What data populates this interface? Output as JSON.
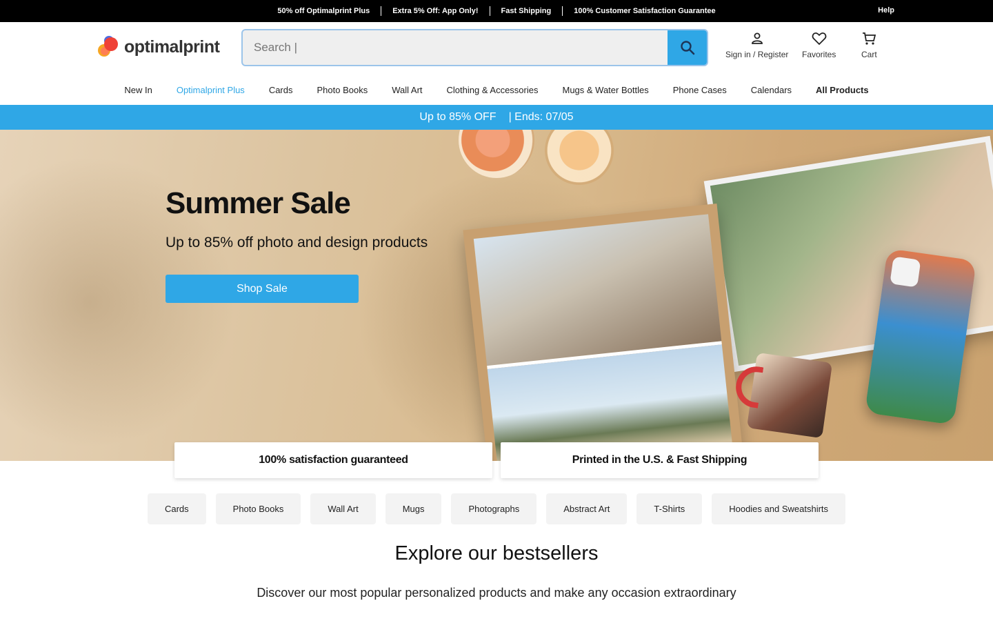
{
  "topbar": {
    "promos": [
      "50% off Optimalprint Plus",
      "Extra 5% Off: App Only!",
      "Fast Shipping",
      "100% Customer Satisfaction Guarantee"
    ],
    "help": "Help"
  },
  "header": {
    "logo_text": "optimalprint",
    "search_placeholder": "Search |",
    "actions": {
      "account": "Sign in / Register",
      "favorites": "Favorites",
      "cart": "Cart"
    }
  },
  "nav": {
    "items": [
      "New In",
      "Optimalprint Plus",
      "Cards",
      "Photo Books",
      "Wall Art",
      "Clothing & Accessories",
      "Mugs & Water Bottles",
      "Phone Cases",
      "Calendars",
      "All Products"
    ]
  },
  "sale_bar": {
    "offer": "Up to 85% OFF",
    "ends": "| Ends: 07/05"
  },
  "hero": {
    "title": "Summer Sale",
    "subtitle": "Up to 85% off photo and design products",
    "cta": "Shop Sale"
  },
  "features": [
    "100% satisfaction guaranteed",
    "Printed in the U.S. & Fast Shipping"
  ],
  "chips": [
    "Cards",
    "Photo Books",
    "Wall Art",
    "Mugs",
    "Photographs",
    "Abstract Art",
    "T-Shirts",
    "Hoodies and Sweatshirts"
  ],
  "bestsellers": {
    "title": "Explore our bestsellers",
    "subtitle": "Discover our most popular personalized products and make any occasion extraordinary"
  },
  "colors": {
    "accent": "#2fa7e6",
    "topbar": "#000000"
  },
  "icons": [
    "search-icon",
    "user-icon",
    "heart-icon",
    "cart-icon"
  ]
}
